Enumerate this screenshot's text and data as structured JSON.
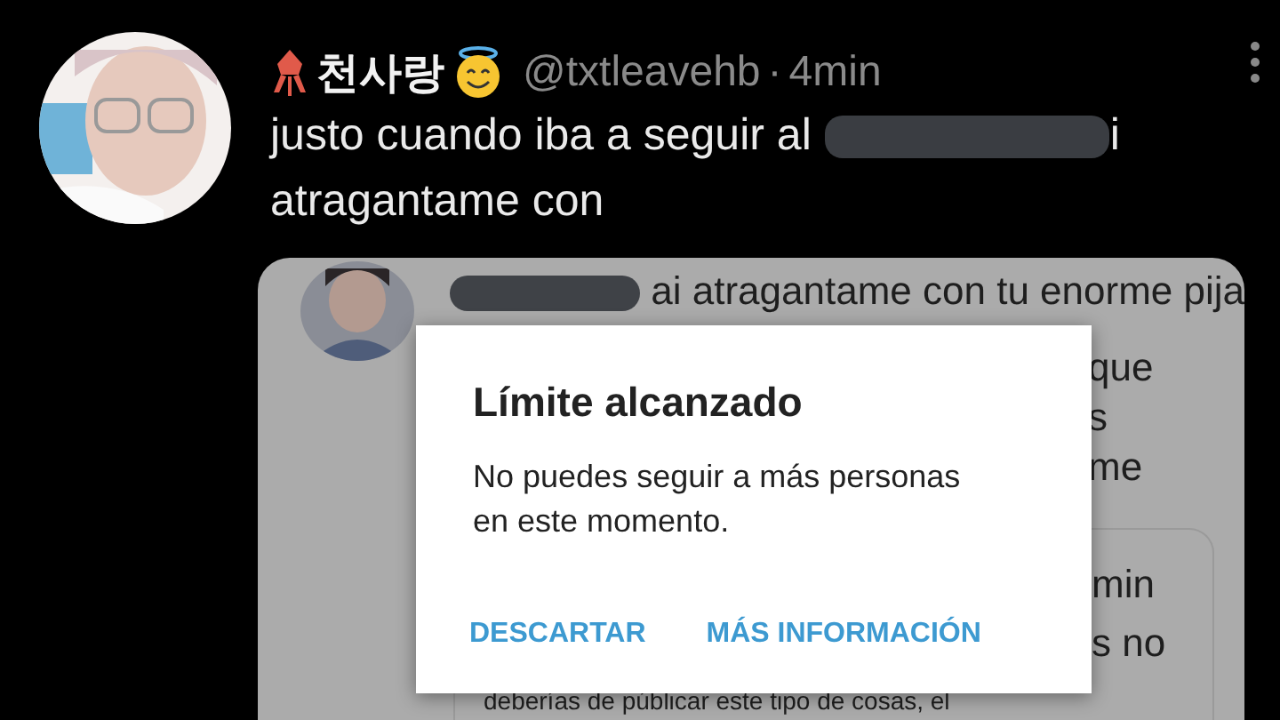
{
  "tweet": {
    "name": "천사랑",
    "handle": "@txtleavehb",
    "separator": "·",
    "time": "4min",
    "text_start": "justo cuando iba a seguir al",
    "text_after_redaction": "i",
    "text_line2": "atragantame con"
  },
  "quoted_tweet": {
    "first_line": "ai atragantame con tu enorme pija",
    "fragments": [
      "que",
      "s",
      "me"
    ],
    "inner_card": {
      "fragments": [
        "min",
        "s no"
      ],
      "last_line": "deberías de públicar este tipo de cosas, el"
    }
  },
  "dialog": {
    "title": "Límite alcanzado",
    "message": "No puedes seguir a más personas en este momento.",
    "buttons": [
      "DESCARTAR",
      "MÁS INFORMACIÓN"
    ]
  }
}
